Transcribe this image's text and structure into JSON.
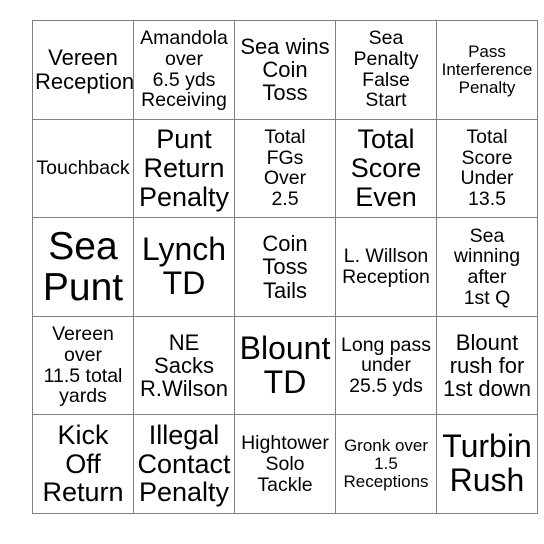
{
  "card": {
    "type": "bingo-card",
    "rows": 5,
    "columns": 5,
    "border_color": "#808080",
    "background_color": "#ffffff",
    "text_color": "#000000",
    "cells": [
      [
        {
          "text": "Vereen\nReception",
          "size": "m"
        },
        {
          "text": "Amandola\nover\n6.5 yds\nReceiving",
          "size": "s"
        },
        {
          "text": "Sea wins\nCoin Toss",
          "size": "m"
        },
        {
          "text": "Sea\nPenalty\nFalse\nStart",
          "size": "s"
        },
        {
          "text": "Pass\nInterference\nPenalty",
          "size": "xs"
        }
      ],
      [
        {
          "text": "Touchback",
          "size": "s"
        },
        {
          "text": "Punt\nReturn\nPenalty",
          "size": "l"
        },
        {
          "text": "Total\nFGs\nOver\n2.5",
          "size": "s"
        },
        {
          "text": "Total\nScore\nEven",
          "size": "l"
        },
        {
          "text": "Total\nScore\nUnder\n13.5",
          "size": "s"
        }
      ],
      [
        {
          "text": "Sea\nPunt",
          "size": "xxl"
        },
        {
          "text": "Lynch\nTD",
          "size": "xl"
        },
        {
          "text": "Coin\nToss\nTails",
          "size": "m"
        },
        {
          "text": "L. Willson\nReception",
          "size": "s"
        },
        {
          "text": "Sea\nwinning\nafter\n1st Q",
          "size": "s"
        }
      ],
      [
        {
          "text": "Vereen\nover\n11.5 total\nyards",
          "size": "s"
        },
        {
          "text": "NE\nSacks\nR.Wilson",
          "size": "m"
        },
        {
          "text": "Blount\nTD",
          "size": "xl"
        },
        {
          "text": "Long pass\nunder\n25.5 yds",
          "size": "s"
        },
        {
          "text": "Blount\nrush for\n1st down",
          "size": "m"
        }
      ],
      [
        {
          "text": "Kick\nOff\nReturn",
          "size": "l"
        },
        {
          "text": "Illegal\nContact\nPenalty",
          "size": "l"
        },
        {
          "text": "Hightower\nSolo\nTackle",
          "size": "s"
        },
        {
          "text": "Gronk over\n1.5\nReceptions",
          "size": "xs"
        },
        {
          "text": "Turbin\nRush",
          "size": "xl"
        }
      ]
    ]
  }
}
